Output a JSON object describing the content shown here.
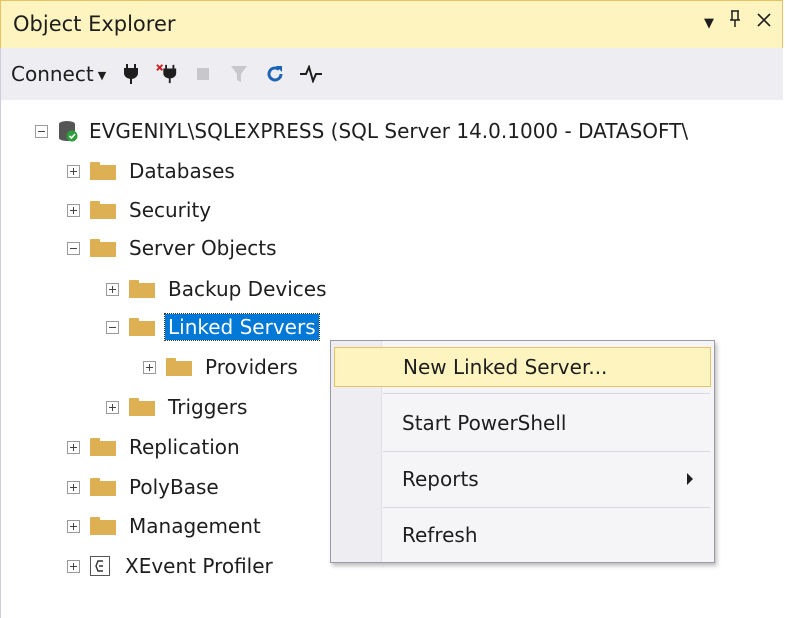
{
  "window": {
    "title": "Object Explorer",
    "controls": {
      "dropdown": "▾",
      "pin": "ᵖ",
      "close": "✕"
    }
  },
  "toolbar": {
    "connect_label": "Connect",
    "connect_caret": "▾",
    "icons": [
      "connect-plug-icon",
      "disconnect-plug-icon",
      "stop-icon",
      "filter-icon",
      "refresh-icon",
      "activity-monitor-icon"
    ]
  },
  "tree": {
    "server": "EVGENIYL\\SQLEXPRESS (SQL Server 14.0.1000 - DATASOFT\\",
    "items": [
      {
        "label": "Databases"
      },
      {
        "label": "Security"
      },
      {
        "label": "Server Objects"
      },
      {
        "label": "Backup Devices"
      },
      {
        "label": "Linked Servers"
      },
      {
        "label": "Providers"
      },
      {
        "label": "Triggers"
      },
      {
        "label": "Replication"
      },
      {
        "label": "PolyBase"
      },
      {
        "label": "Management"
      },
      {
        "label": "XEvent Profiler"
      }
    ]
  },
  "context_menu": {
    "items": [
      {
        "label": "New Linked Server..."
      },
      {
        "label": "Start PowerShell"
      },
      {
        "label": "Reports"
      },
      {
        "label": "Refresh"
      }
    ]
  },
  "colors": {
    "title_bg": "#fdf4bf",
    "selection": "#0078d7",
    "folder": "#dcb053",
    "menu_hover": "#fdf4bf"
  }
}
